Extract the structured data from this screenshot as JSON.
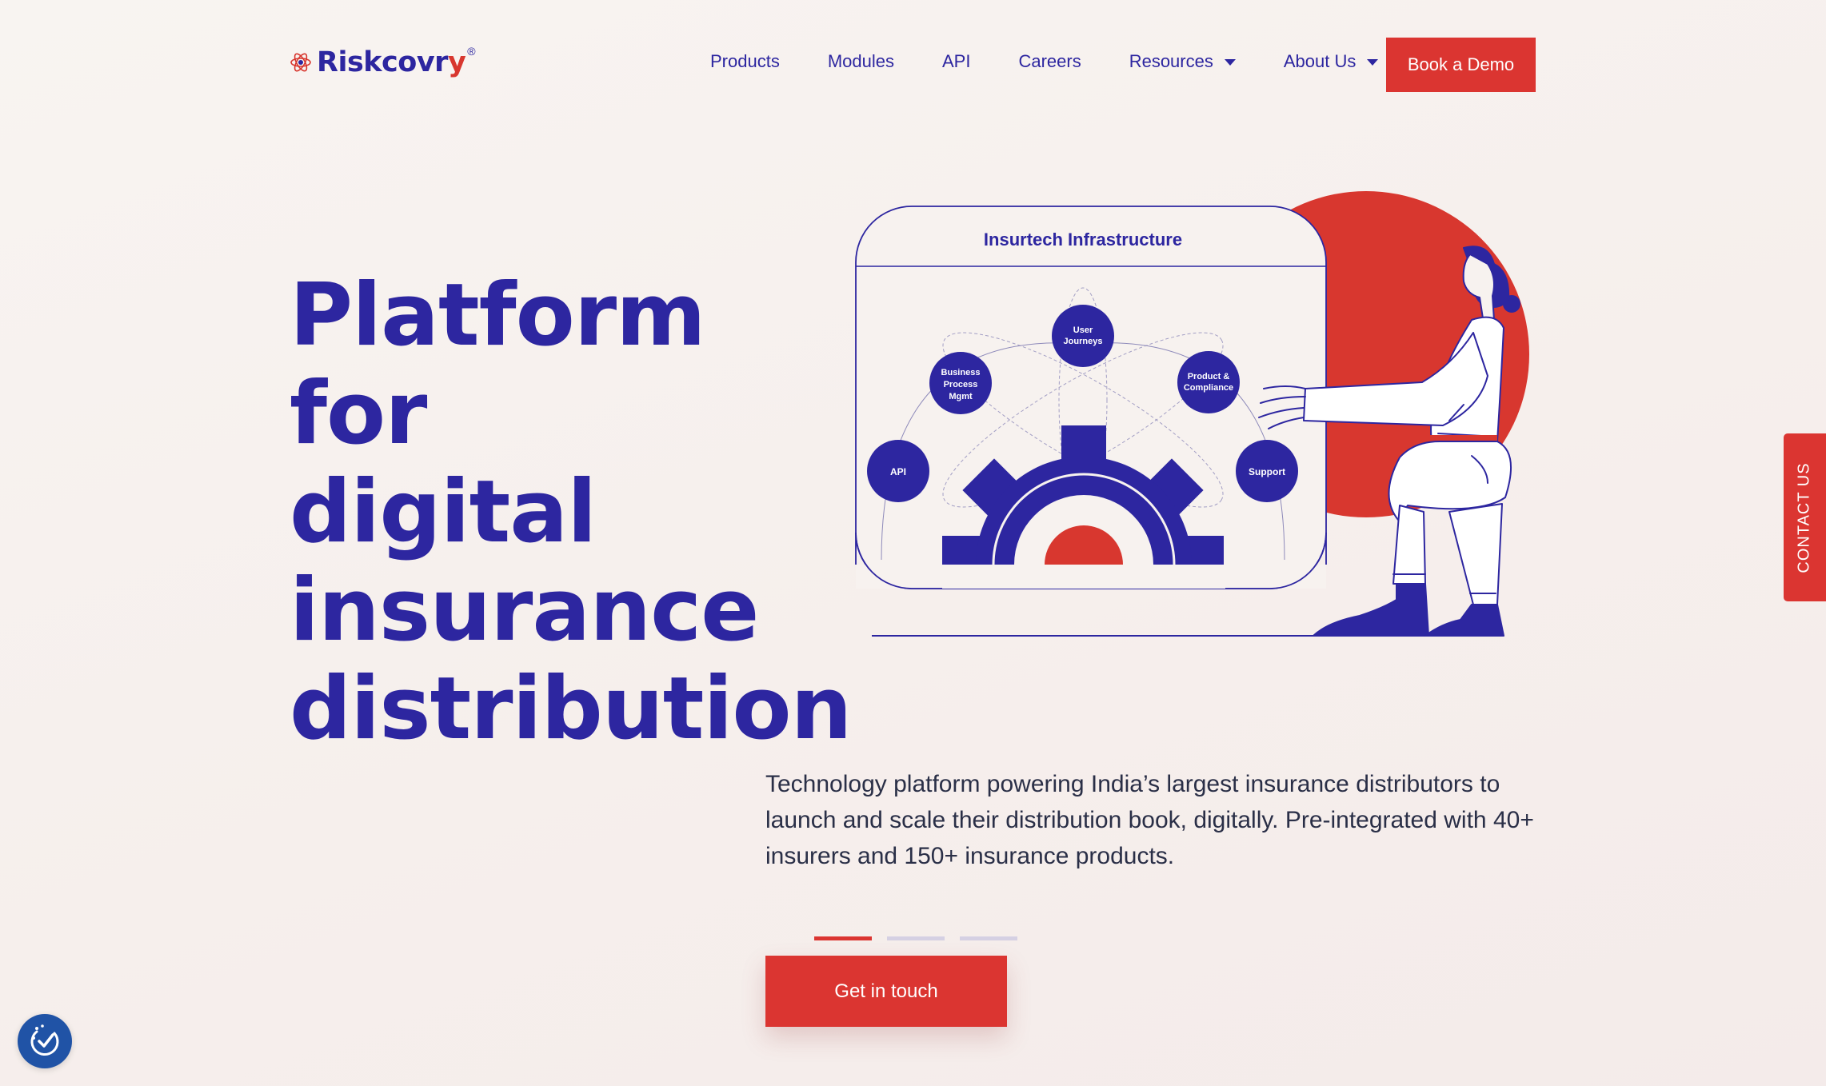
{
  "brand": {
    "name_main": "Riskcovr",
    "name_accent": "y",
    "reg": "®"
  },
  "nav": {
    "items": [
      {
        "label": "Products",
        "has_caret": false
      },
      {
        "label": "Modules",
        "has_caret": false
      },
      {
        "label": "API",
        "has_caret": false
      },
      {
        "label": "Careers",
        "has_caret": false
      },
      {
        "label": "Resources",
        "has_caret": true
      },
      {
        "label": "About Us",
        "has_caret": true
      }
    ],
    "cta_label": "Book a Demo"
  },
  "hero": {
    "title_lines": [
      "Platform for",
      "digital",
      "insurance",
      "distribution"
    ],
    "description": "Technology platform powering India’s largest insurance distributors to launch and scale their distribution book, digitally. Pre-integrated with 40+ insurers and 150+ insurance products.",
    "cta_label": "Get in touch",
    "carousel": {
      "slides": 3,
      "active": 0
    }
  },
  "illustration": {
    "title": "Insurtech Infrastructure",
    "nodes": {
      "api": "API",
      "bpm": [
        "Business",
        "Process",
        "Mgmt"
      ],
      "journeys": [
        "User",
        "Journeys"
      ],
      "compliance": [
        "Product &",
        "Compliance"
      ],
      "support": "Support"
    }
  },
  "side_tab": {
    "label": "CONTACT US"
  },
  "colors": {
    "primary": "#2d26a0",
    "accent": "#db3531",
    "text": "#2a2f47",
    "background": "#f7f1ee"
  },
  "icons": {
    "accessibility": "accessibility-icon",
    "dropdown": "chevron-down-icon",
    "logo": "atom-icon"
  }
}
